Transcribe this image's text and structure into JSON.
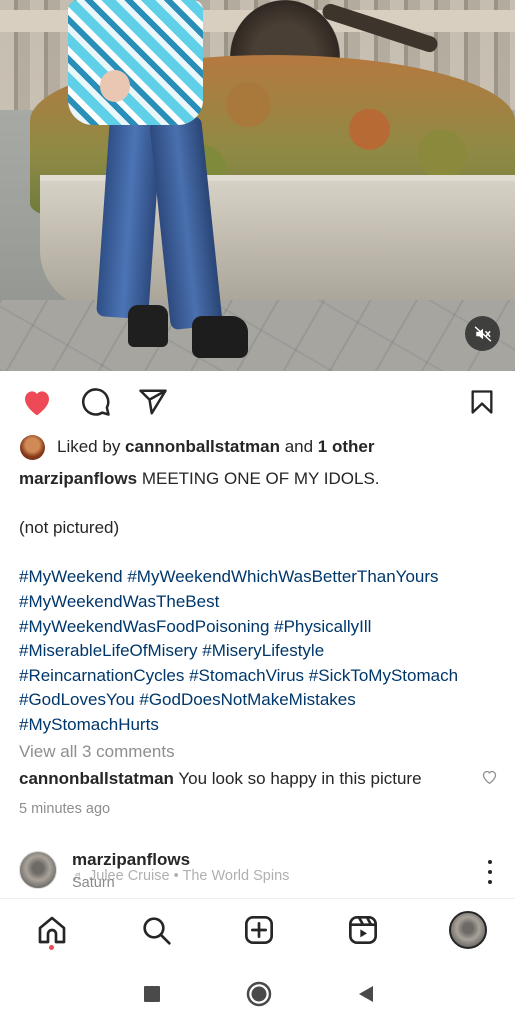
{
  "post": {
    "media": {
      "type": "video",
      "muted_icon": "speaker-muted-icon"
    },
    "actions": {
      "like_icon": "heart-filled-icon",
      "comment_icon": "comment-icon",
      "share_icon": "send-icon",
      "save_icon": "bookmark-icon",
      "liked": true,
      "like_color": "#ed4956"
    },
    "likes": {
      "prefix": "Liked by ",
      "user": "cannonballstatman",
      "joiner": " and ",
      "others": "1 other"
    },
    "caption": {
      "username": "marzipanflows",
      "text": " MEETING ONE OF MY IDOLS.",
      "line2": "(not pictured)",
      "hashtag_lines": [
        "#MyWeekend #MyWeekendWhichWasBetterThanYours",
        "#MyWeekendWasTheBest",
        "#MyWeekendWasFoodPoisoning #PhysicallyIll",
        "#MiserableLifeOfMisery #MiseryLifestyle",
        "#ReincarnationCycles #StomachVirus #SickToMyStomach",
        "#GodLovesYou #GodDoesNotMakeMistakes",
        "#MyStomachHurts"
      ],
      "hashtag_color": "#00376b"
    },
    "view_comments": "View all 3 comments",
    "top_comment": {
      "username": "cannonballstatman",
      "text": " You look so happy in this picture"
    },
    "time_ago": "5 minutes ago"
  },
  "next_post": {
    "username": "marzipanflows",
    "music": "Julee Cruise • The World Spins",
    "location": "Saturn"
  },
  "bottom_nav": {
    "items": [
      "home-icon",
      "search-icon",
      "create-icon",
      "reels-icon",
      "profile-avatar"
    ],
    "active": "home-icon"
  },
  "system_nav": [
    "recents-button",
    "home-button",
    "back-button"
  ]
}
